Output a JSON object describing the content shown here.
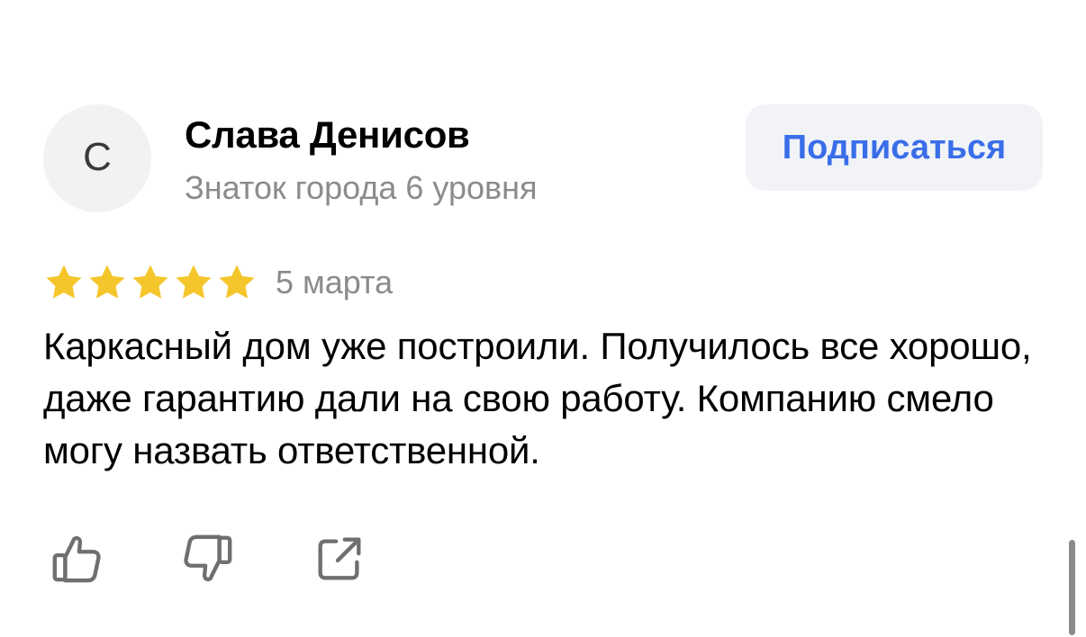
{
  "author": {
    "avatar_letter": "С",
    "name": "Слава Денисов",
    "level": "Знаток города 6 уровня"
  },
  "subscribe": {
    "label": "Подписаться"
  },
  "review": {
    "rating": 5,
    "rating_max": 5,
    "date": "5 марта",
    "text": "Каркасный дом уже построили. Получилось все хорошо, даже гарантию дали на свою работу. Компанию смело могу назвать ответственной."
  },
  "actions": {
    "icons": [
      "thumbs-up-icon",
      "thumbs-down-icon",
      "share-icon"
    ]
  },
  "colors": {
    "star": "#f5c62b",
    "accent": "#3a6ee8",
    "secondary_text": "#8b8b8b",
    "button_bg": "#f1f3f7",
    "icon": "#6f6f6f"
  }
}
